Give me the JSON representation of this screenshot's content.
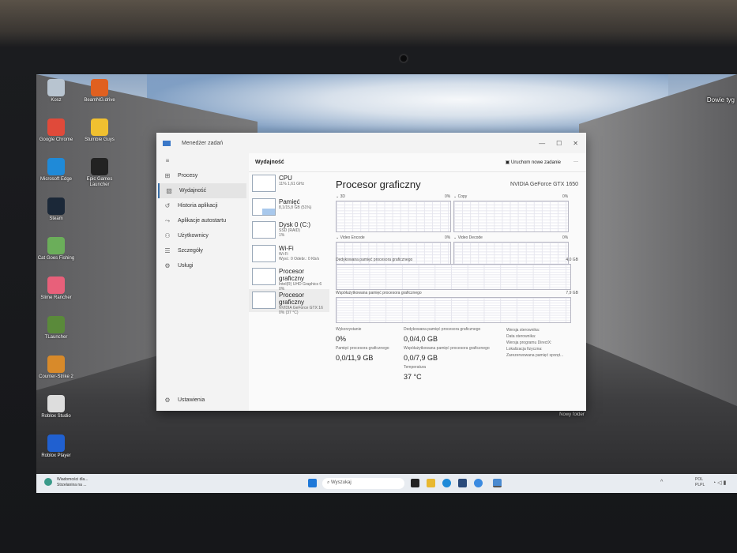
{
  "desktop": {
    "icons": [
      {
        "label": "Kosz",
        "color": "#b8c4d0"
      },
      {
        "label": "Google Chrome",
        "color": "#e04a3a"
      },
      {
        "label": "Microsoft Edge",
        "color": "#1f8ad8"
      },
      {
        "label": "Steam",
        "color": "#1b2838"
      },
      {
        "label": "Cat Goes Fishing",
        "color": "#6bae5a"
      },
      {
        "label": "Slime Rancher",
        "color": "#e8607a"
      },
      {
        "label": "TLauncher",
        "color": "#5a8a3a"
      },
      {
        "label": "Counter-Strike 2",
        "color": "#d88a2a"
      },
      {
        "label": "Roblox Studio",
        "color": "#ddd"
      },
      {
        "label": "Roblox Player",
        "color": "#2060d0"
      }
    ],
    "icons2": [
      {
        "label": "BeamNG.drive",
        "color": "#e06020"
      },
      {
        "label": "Stumble Guys",
        "color": "#f0c030"
      },
      {
        "label": "Epic Games Launcher",
        "color": "#222"
      }
    ],
    "folder_label": "Nowy folder",
    "right_label": "Dowie tyg"
  },
  "window": {
    "title": "Menedżer zadań",
    "controls": [
      "—",
      "☐",
      "✕"
    ]
  },
  "sidebar": {
    "items": [
      {
        "label": "Procesy",
        "icon": "grid-icon"
      },
      {
        "label": "Wydajność",
        "icon": "chart-icon"
      },
      {
        "label": "Historia aplikacji",
        "icon": "history-icon"
      },
      {
        "label": "Aplikacje autostartu",
        "icon": "startup-icon"
      },
      {
        "label": "Użytkownicy",
        "icon": "users-icon"
      },
      {
        "label": "Szczegóły",
        "icon": "list-icon"
      },
      {
        "label": "Usługi",
        "icon": "services-icon"
      }
    ],
    "settings": "Ustawienia"
  },
  "header": {
    "title": "Wydajność",
    "run_task": "Uruchom nowe zadanie",
    "more": "···"
  },
  "devices": [
    {
      "name": "CPU",
      "l2": "11% 1,61 GHz",
      "l3": ""
    },
    {
      "name": "Pamięć",
      "l2": "8,1/15,8 GB (51%)",
      "l3": ""
    },
    {
      "name": "Dysk 0 (C:)",
      "l2": "SSD (RAID)",
      "l3": "1%"
    },
    {
      "name": "Wi-Fi",
      "l2": "Wi-Fi",
      "l3": "Wysł.: 0 Odebr.: 0 Kb/s"
    },
    {
      "name": "Procesor graficzny",
      "l2": "Intel(R) UHD Graphics 6",
      "l3": "0%"
    },
    {
      "name": "Procesor graficzny",
      "l2": "NVIDIA GeForce GTX 16",
      "l3": "0% (37 °C)"
    }
  ],
  "detail": {
    "title": "Procesor graficzny",
    "gpu": "NVIDIA GeForce GTX 1650",
    "engines": [
      {
        "name": "3D",
        "pct": "0%"
      },
      {
        "name": "Copy",
        "pct": "0%"
      },
      {
        "name": "Video Encode",
        "pct": "0%"
      },
      {
        "name": "Video Decode",
        "pct": "0%"
      }
    ],
    "dedicated_label": "Dedykowana pamięć procesora graficznego",
    "dedicated_max": "4,0 GB",
    "shared_label": "Współużytkowana pamięć procesora graficznego",
    "shared_max": "7,9 GB",
    "stats": {
      "util_label": "Wykorzystanie",
      "util": "0%",
      "gpu_mem_label": "Pamięć procesora graficznego",
      "gpu_mem": "0,0/11,9 GB",
      "ded_label": "Dedykowana pamięć procesora graficznego",
      "ded": "0,0/4,0 GB",
      "shared_label": "Współużytkowana pamięć procesora graficznego",
      "shared": "0,0/7,9 GB",
      "temp_label": "Temperatura",
      "temp": "37 °C"
    },
    "info": [
      "Wersja sterownika:",
      "Data sterownika:",
      "Wersja programu DirectX:",
      "Lokalizacja fizyczna:",
      "Zarezerwowana pamięć sprzęt..."
    ]
  },
  "taskbar": {
    "news1": "Wiadomości dla...",
    "news2": "Strzelanina na ...",
    "search": "Wyszukaj",
    "lang1": "POL",
    "lang2": "PLPL"
  }
}
